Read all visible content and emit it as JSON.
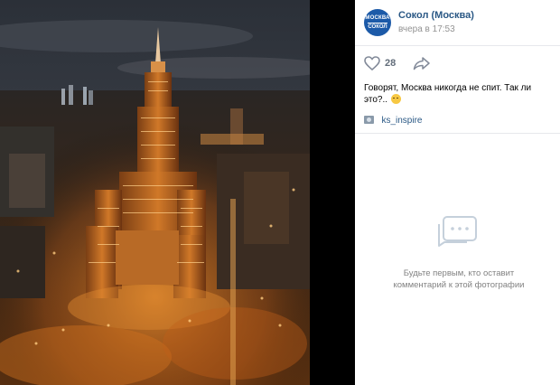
{
  "post": {
    "group_name": "Сокол (Москва)",
    "time": "вчера в 17:53",
    "avatar_top": "МОСКВА",
    "avatar_bottom": "СОКОЛ",
    "likes": "28",
    "text": "Говорят, Москва никогда не спит. Так ли это?..",
    "tag": "ks_inspire"
  },
  "comments": {
    "empty_line1": "Будьте первым, кто оставит",
    "empty_line2": "комментарий к этой фотографии"
  },
  "colors": {
    "link": "#2a5885",
    "muted": "#939393",
    "avatar_bg": "#1c5aa8"
  },
  "icons": [
    "heart-icon",
    "share-arrow-icon",
    "photo-tag-icon",
    "comment-bubble-icon",
    "emoji-sweat-smile-icon"
  ]
}
